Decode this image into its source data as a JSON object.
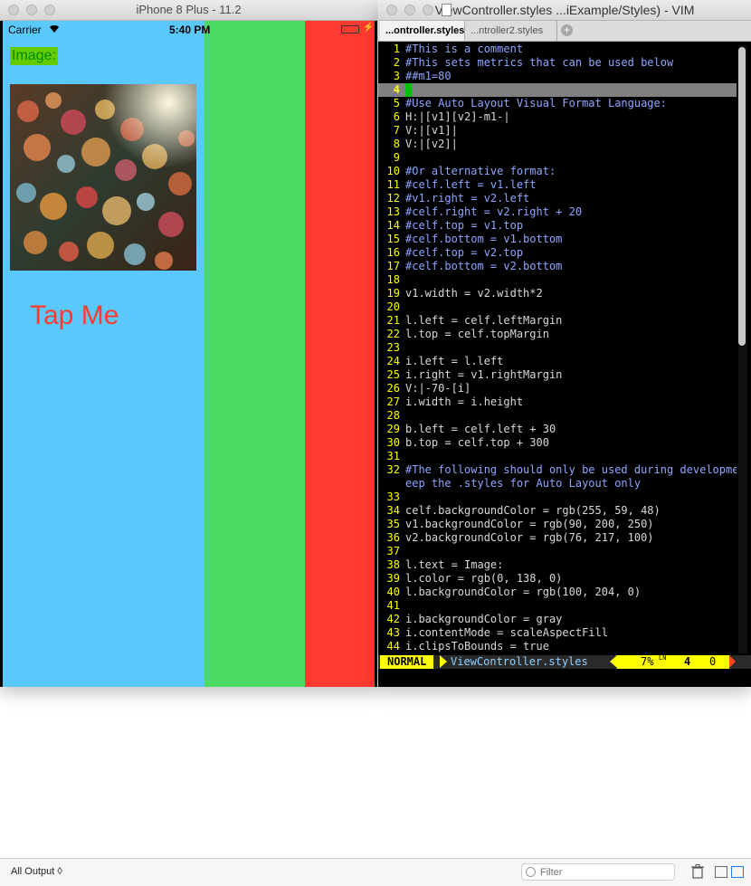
{
  "simulator": {
    "title": "iPhone 8 Plus - 11.2",
    "status": {
      "carrier": "Carrier",
      "time": "5:40 PM",
      "battery_level": 1.0
    },
    "image_label": "Image:",
    "button_label": "Tap Me",
    "colors": {
      "v1": "#5ac8fa",
      "v2": "#4cd964",
      "root": "#ff3b30",
      "label_bg": "#64cc00",
      "label_text": "#008a00"
    }
  },
  "vim": {
    "title": "ViewController.styles ...iExample/Styles) - VIM",
    "tabs": [
      {
        "label": "...ontroller.styles",
        "active": true
      },
      {
        "label": "...ntroller2.styles",
        "active": false
      }
    ],
    "cursor_line": "4",
    "lines": [
      {
        "n": "1",
        "text": "#This is a comment",
        "kind": "comment"
      },
      {
        "n": "2",
        "text": "#This sets metrics that can be used below",
        "kind": "comment"
      },
      {
        "n": "3",
        "text": "##m1=80",
        "kind": "comment"
      },
      {
        "n": "4",
        "text": "",
        "kind": "normal"
      },
      {
        "n": "5",
        "text": "#Use Auto Layout Visual Format Language:",
        "kind": "comment"
      },
      {
        "n": "6",
        "text": "H:|[v1][v2]-m1-|",
        "kind": "normal"
      },
      {
        "n": "7",
        "text": "V:|[v1]|",
        "kind": "normal"
      },
      {
        "n": "8",
        "text": "V:|[v2]|",
        "kind": "normal"
      },
      {
        "n": "9",
        "text": "",
        "kind": "normal"
      },
      {
        "n": "10",
        "text": "#Or alternative format:",
        "kind": "comment"
      },
      {
        "n": "11",
        "text": "#celf.left = v1.left",
        "kind": "comment"
      },
      {
        "n": "12",
        "text": "#v1.right = v2.left",
        "kind": "comment"
      },
      {
        "n": "13",
        "text": "#celf.right = v2.right + 20",
        "kind": "comment"
      },
      {
        "n": "14",
        "text": "#celf.top = v1.top",
        "kind": "comment"
      },
      {
        "n": "15",
        "text": "#celf.bottom = v1.bottom",
        "kind": "comment"
      },
      {
        "n": "16",
        "text": "#celf.top = v2.top",
        "kind": "comment"
      },
      {
        "n": "17",
        "text": "#celf.bottom = v2.bottom",
        "kind": "comment"
      },
      {
        "n": "18",
        "text": "",
        "kind": "normal"
      },
      {
        "n": "19",
        "text": "v1.width = v2.width*2",
        "kind": "normal"
      },
      {
        "n": "20",
        "text": "",
        "kind": "normal"
      },
      {
        "n": "21",
        "text": "l.left = celf.leftMargin",
        "kind": "normal"
      },
      {
        "n": "22",
        "text": "l.top = celf.topMargin",
        "kind": "normal"
      },
      {
        "n": "23",
        "text": "",
        "kind": "normal"
      },
      {
        "n": "24",
        "text": "i.left = l.left",
        "kind": "normal"
      },
      {
        "n": "25",
        "text": "i.right = v1.rightMargin",
        "kind": "normal"
      },
      {
        "n": "26",
        "text": "V:|-70-[i]",
        "kind": "normal"
      },
      {
        "n": "27",
        "text": "i.width = i.height",
        "kind": "normal"
      },
      {
        "n": "28",
        "text": "",
        "kind": "normal"
      },
      {
        "n": "29",
        "text": "b.left = celf.left + 30",
        "kind": "normal"
      },
      {
        "n": "30",
        "text": "b.top = celf.top + 300",
        "kind": "normal"
      },
      {
        "n": "31",
        "text": "",
        "kind": "normal"
      },
      {
        "n": "32",
        "text": "#The following should only be used during development only. Keep the .styles for Auto Layout only",
        "kind": "comment"
      },
      {
        "n": "33",
        "text": "",
        "kind": "normal"
      },
      {
        "n": "34",
        "text": "celf.backgroundColor = rgb(255, 59, 48)",
        "kind": "normal"
      },
      {
        "n": "35",
        "text": "v1.backgroundColor = rgb(90, 200, 250)",
        "kind": "normal"
      },
      {
        "n": "36",
        "text": "v2.backgroundColor = rgb(76, 217, 100)",
        "kind": "normal"
      },
      {
        "n": "37",
        "text": "",
        "kind": "normal"
      },
      {
        "n": "38",
        "text": "l.text = Image:",
        "kind": "normal"
      },
      {
        "n": "39",
        "text": "l.color = rgb(0, 138, 0)",
        "kind": "normal"
      },
      {
        "n": "40",
        "text": "l.backgroundColor = rgb(100, 204, 0)",
        "kind": "normal"
      },
      {
        "n": "41",
        "text": "",
        "kind": "normal"
      },
      {
        "n": "42",
        "text": "i.backgroundColor = gray",
        "kind": "normal"
      },
      {
        "n": "43",
        "text": "i.contentMode = scaleAspectFill",
        "kind": "normal"
      },
      {
        "n": "44",
        "text": "i.clipsToBounds = true",
        "kind": "normal"
      }
    ],
    "statusline": {
      "mode": "NORMAL",
      "filename": "ViewController.styles",
      "percent": "7%",
      "ln_symbol": "LN",
      "line": "4",
      "col": "0"
    },
    "colors": {
      "line_number": "#ffff00",
      "comment": "#8fa6ff",
      "text": "#d8d8d8",
      "mode_bg": "#ffff00"
    }
  },
  "debug": {
    "output_selector": "All Output ◊",
    "filter_placeholder": "Filter"
  }
}
